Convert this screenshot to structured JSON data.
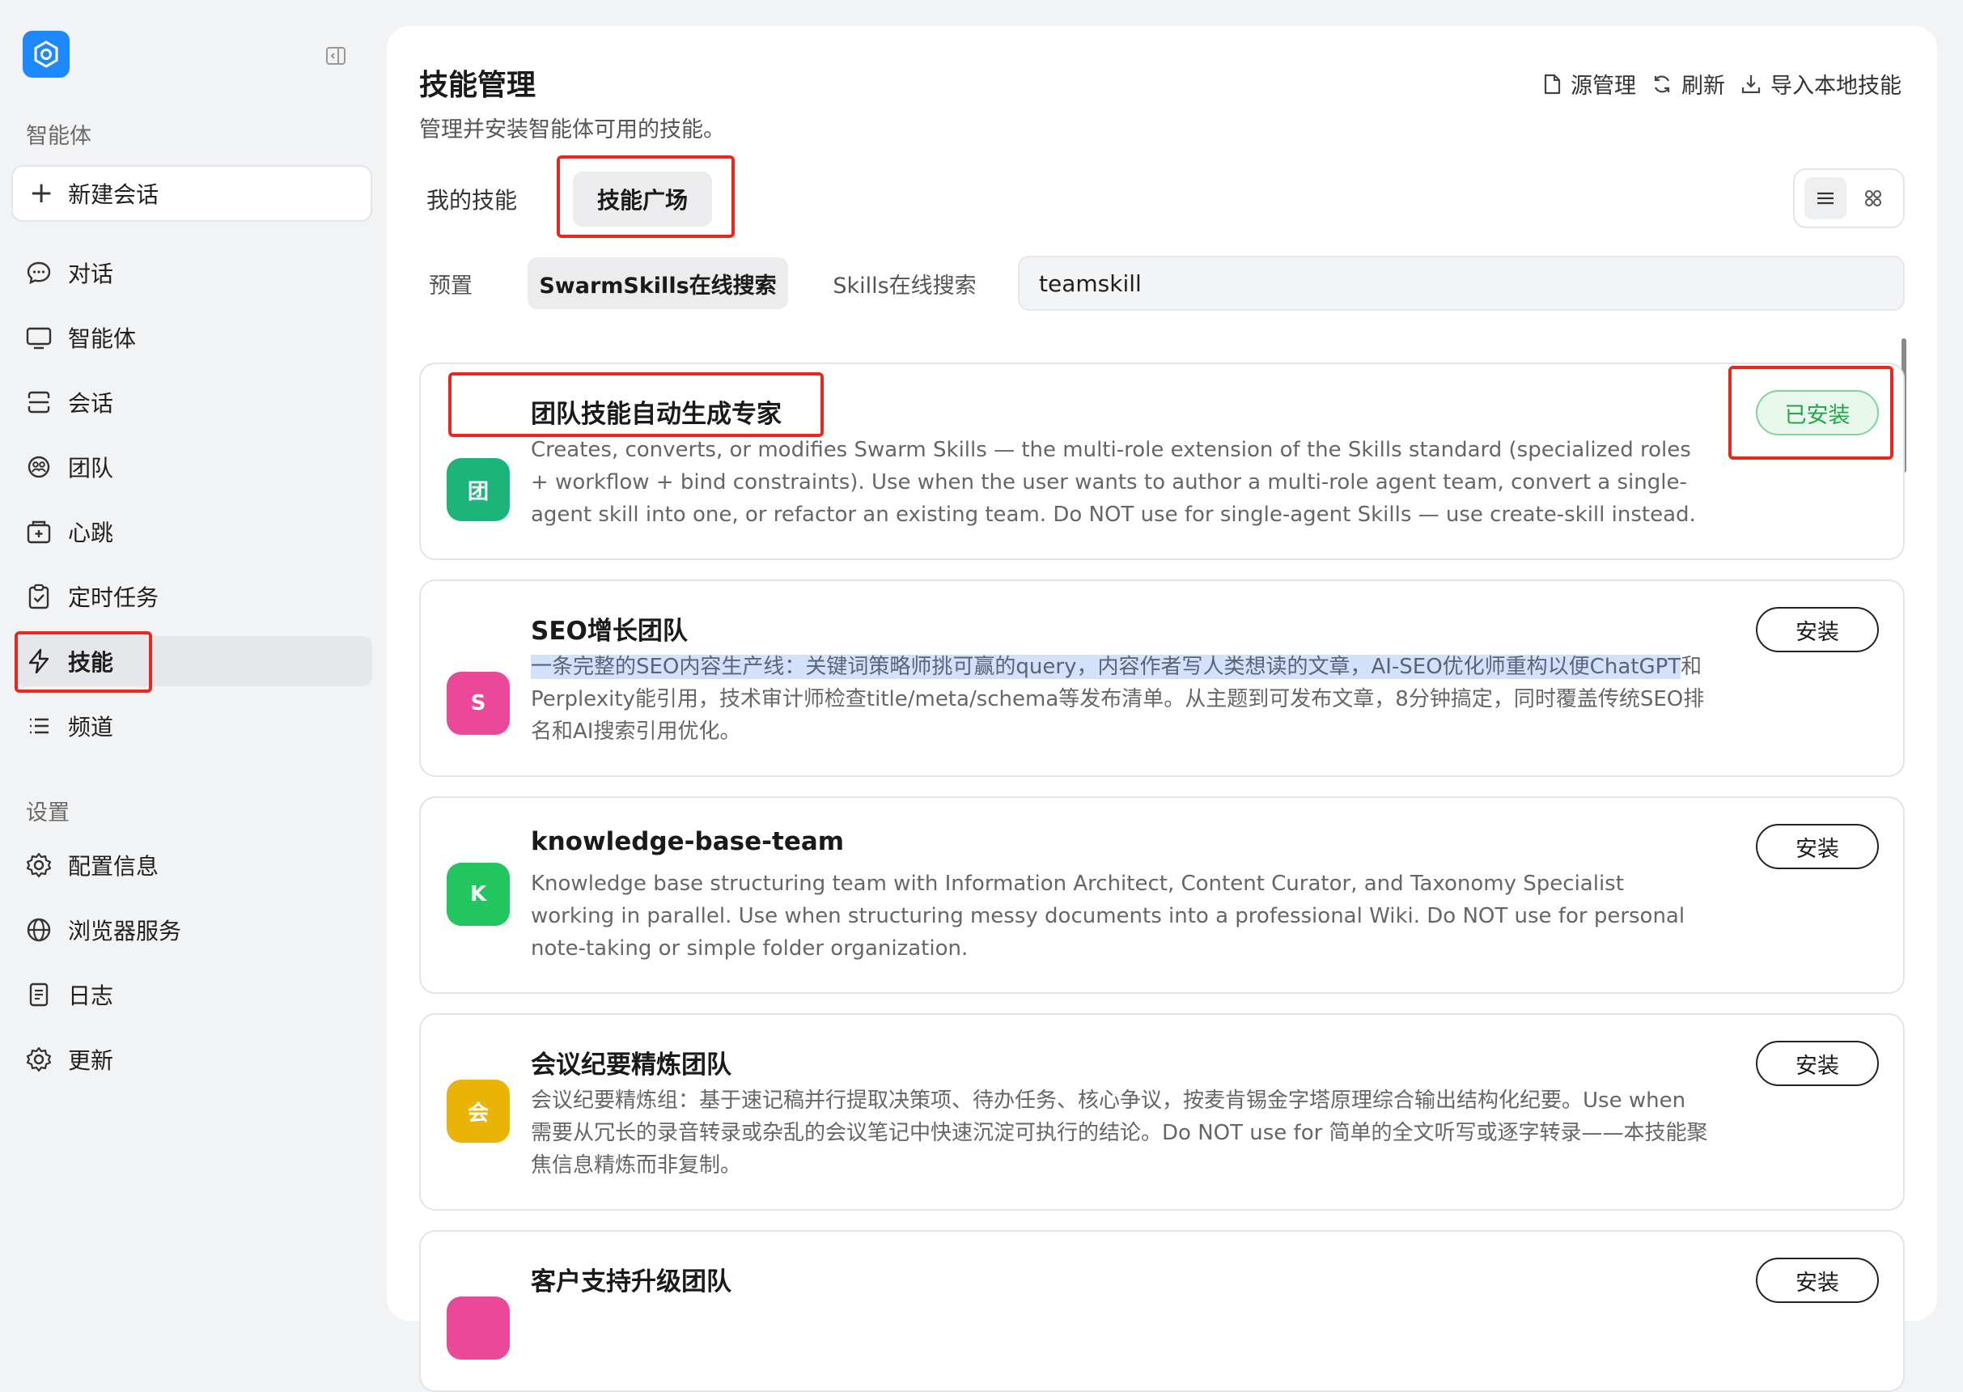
{
  "sidebar": {
    "section_agents": "智能体",
    "new_chat": "新建会话",
    "items": [
      {
        "label": "对话",
        "icon": "chat-icon"
      },
      {
        "label": "智能体",
        "icon": "monitor-icon"
      },
      {
        "label": "会话",
        "icon": "session-icon"
      },
      {
        "label": "团队",
        "icon": "team-icon"
      },
      {
        "label": "心跳",
        "icon": "heartbeat-icon"
      },
      {
        "label": "定时任务",
        "icon": "clipboard-check-icon"
      },
      {
        "label": "技能",
        "icon": "lightning-icon"
      },
      {
        "label": "频道",
        "icon": "list-icon"
      }
    ],
    "section_settings": "设置",
    "settings_items": [
      {
        "label": "配置信息",
        "icon": "gear-icon"
      },
      {
        "label": "浏览器服务",
        "icon": "globe-icon"
      },
      {
        "label": "日志",
        "icon": "log-icon"
      },
      {
        "label": "更新",
        "icon": "gear-icon"
      }
    ]
  },
  "header": {
    "title": "技能管理",
    "subtitle": "管理并安装智能体可用的技能。",
    "actions": {
      "source": "源管理",
      "refresh": "刷新",
      "import": "导入本地技能"
    }
  },
  "tabs": [
    "我的技能",
    "技能广场"
  ],
  "subtabs": [
    "预置",
    "SwarmSkills在线搜索",
    "Skills在线搜索"
  ],
  "search": {
    "value": "teamskill"
  },
  "skills": [
    {
      "badge": "团",
      "color": "#1bb57c",
      "title": "团队技能自动生成专家",
      "desc": "Creates, converts, or modifies Swarm Skills — the multi-role extension of the Skills standard (specialized roles + workflow + bind constraints). Use when the user wants to author a multi-role agent team, convert a single-agent skill into one, or refactor an existing team. Do NOT use for single-agent Skills — use create-skill instead.",
      "status": "已安装"
    },
    {
      "badge": "S",
      "color": "#ec4899",
      "title": "SEO增长团队",
      "desc_highlight": "一条完整的SEO内容生产线：关键词策略师挑可赢的query，内容作者写人类想读的文章，AI-SEO优化师重构以便ChatGPT",
      "desc": "和Perplexity能引用，技术审计师检查title/meta/schema等发布清单。从主题到可发布文章，8分钟搞定，同时覆盖传统SEO排名和AI搜索引用优化。",
      "status": "安装"
    },
    {
      "badge": "K",
      "color": "#22c55e",
      "title": "knowledge-base-team",
      "desc": "Knowledge base structuring team with Information Architect, Content Curator, and Taxonomy Specialist working in parallel. Use when structuring messy documents into a professional Wiki. Do NOT use for personal note-taking or simple folder organization.",
      "status": "安装"
    },
    {
      "badge": "会",
      "color": "#eab308",
      "title": "会议纪要精炼团队",
      "desc": "会议纪要精炼组：基于速记稿并行提取决策项、待办任务、核心争议，按麦肯锡金字塔原理综合输出结构化纪要。Use when 需要从冗长的录音转录或杂乱的会议笔记中快速沉淀可执行的结论。Do NOT use for 简单的全文听写或逐字转录——本技能聚焦信息精炼而非复制。",
      "status": "安装"
    },
    {
      "badge": "",
      "color": "#ec4899",
      "title": "客户支持升级团队",
      "desc": "",
      "status": "安装"
    }
  ]
}
